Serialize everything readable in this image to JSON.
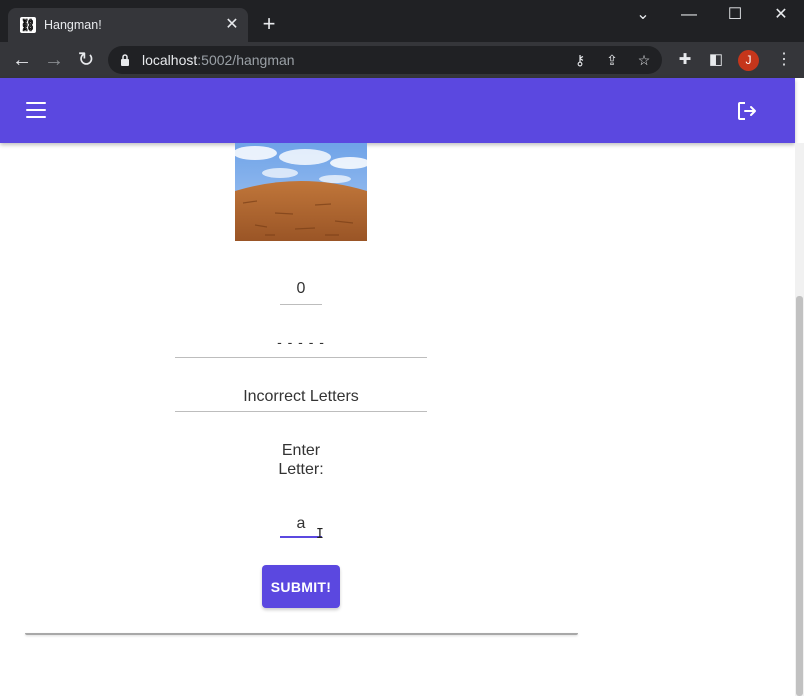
{
  "browser": {
    "tab_title": "Hangman!",
    "tab_favicon": "hangman-favicon",
    "new_tab_icon": "plus-icon",
    "url_host": "localhost",
    "url_path": ":5002/hangman",
    "avatar_initial": "J",
    "avatar_color": "#c5361b"
  },
  "app": {
    "header_color": "#5b48e0",
    "menu_icon": "hamburger-menu-icon",
    "logout_icon": "logout-icon"
  },
  "game": {
    "guess_count": "0",
    "word_display": "- - - - -",
    "incorrect_label": "Incorrect Letters",
    "enter_label_line1": "Enter",
    "enter_label_line2": "Letter:",
    "letter_value": "a",
    "submit_label": "SUBMIT!"
  }
}
